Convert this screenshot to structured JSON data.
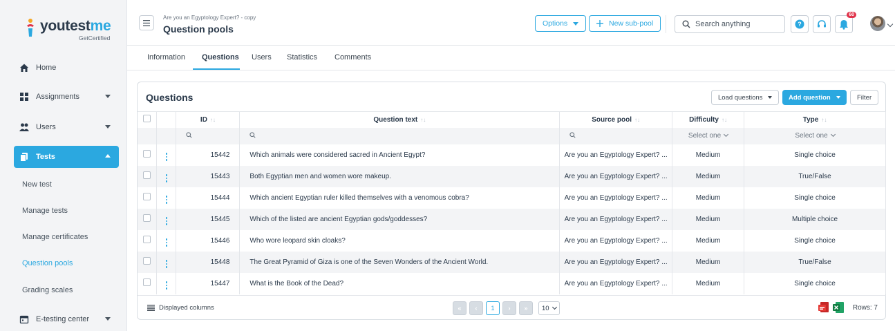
{
  "logo": {
    "word_main": "youtest",
    "word_accent": "me",
    "tagline": "GetCertified"
  },
  "sidebar": {
    "items": [
      {
        "label": "Home",
        "icon": "home-icon"
      },
      {
        "label": "Assignments",
        "icon": "assignments-icon"
      },
      {
        "label": "Users",
        "icon": "users-icon"
      },
      {
        "label": "Tests",
        "icon": "tests-icon",
        "active": true
      },
      {
        "label": "E-testing center",
        "icon": "calendar-icon"
      }
    ],
    "sub_items": [
      {
        "label": "New test"
      },
      {
        "label": "Manage tests"
      },
      {
        "label": "Manage certificates"
      },
      {
        "label": "Question pools",
        "active": true
      },
      {
        "label": "Grading scales"
      }
    ]
  },
  "header": {
    "breadcrumb": "Are you an Egyptology Expert? - copy",
    "title": "Question pools",
    "options_label": "Options",
    "new_subpool_label": "New sub-pool",
    "search_placeholder": "Search anything",
    "notification_count": "60",
    "help_icon": "help-icon",
    "support_icon": "headset-icon",
    "bell_icon": "bell-icon"
  },
  "tabs": [
    {
      "label": "Information"
    },
    {
      "label": "Questions",
      "active": true
    },
    {
      "label": "Users"
    },
    {
      "label": "Statistics"
    },
    {
      "label": "Comments"
    }
  ],
  "questions": {
    "title": "Questions",
    "load_questions_label": "Load questions",
    "add_question_label": "Add question",
    "filter_label": "Filter",
    "columns": {
      "id": "ID",
      "text": "Question text",
      "source": "Source pool",
      "difficulty": "Difficulty",
      "type": "Type"
    },
    "sort_glyph": "↑↓",
    "filter_select": "Select one",
    "rows": [
      {
        "id": "15442",
        "text": "Which animals were considered sacred in Ancient Egypt?",
        "source": "Are you an Egyptology Expert? ...",
        "difficulty": "Medium",
        "type": "Single choice"
      },
      {
        "id": "15443",
        "text": "Both Egyptian men and women wore makeup.",
        "source": "Are you an Egyptology Expert? ...",
        "difficulty": "Medium",
        "type": "True/False"
      },
      {
        "id": "15444",
        "text": "Which ancient Egyptian ruler killed themselves with a venomous cobra?",
        "source": "Are you an Egyptology Expert? ...",
        "difficulty": "Medium",
        "type": "Single choice"
      },
      {
        "id": "15445",
        "text": "Which of the listed are ancient Egyptian gods/goddesses?",
        "source": "Are you an Egyptology Expert? ...",
        "difficulty": "Medium",
        "type": "Multiple choice"
      },
      {
        "id": "15446",
        "text": "Who wore leopard skin cloaks?",
        "source": "Are you an Egyptology Expert? ...",
        "difficulty": "Medium",
        "type": "Single choice"
      },
      {
        "id": "15448",
        "text": "The Great Pyramid of Giza is one of the Seven Wonders of the Ancient World.",
        "source": "Are you an Egyptology Expert? ...",
        "difficulty": "Medium",
        "type": "True/False"
      },
      {
        "id": "15447",
        "text": "What is the Book of the Dead?",
        "source": "Are you an Egyptology Expert? ...",
        "difficulty": "Medium",
        "type": "Single choice"
      }
    ],
    "footer": {
      "displayed_columns_label": "Displayed columns",
      "first_glyph": "«",
      "prev_glyph": "‹",
      "current_page": "1",
      "next_glyph": "›",
      "last_glyph": "»",
      "page_size": "10",
      "rows_label": "Rows: 7"
    }
  },
  "colors": {
    "accent": "#2ba8e0",
    "text": "#2b3a4b",
    "badge": "#e0334a"
  }
}
